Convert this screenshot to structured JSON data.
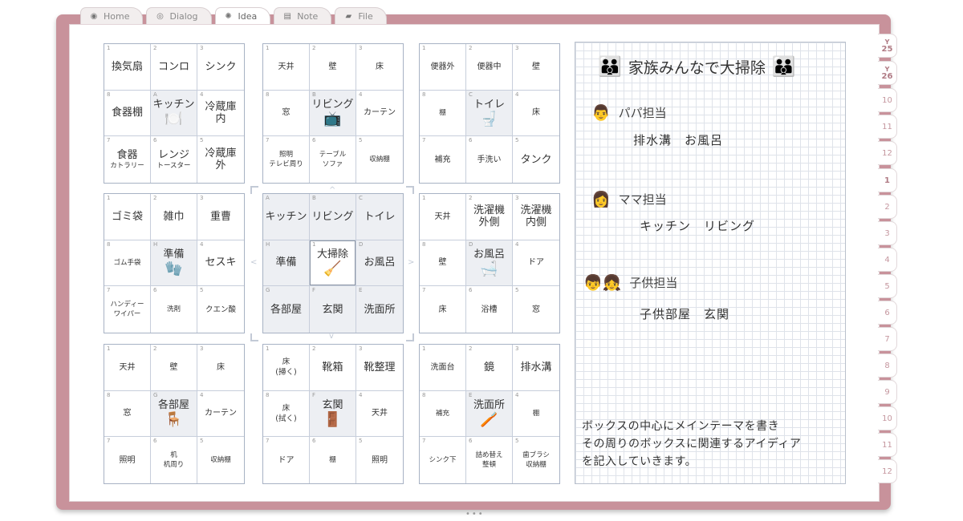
{
  "tabs": [
    {
      "label": "Home",
      "icon": "home-icon",
      "active": false
    },
    {
      "label": "Dialog",
      "icon": "dialog-icon",
      "active": false
    },
    {
      "label": "Idea",
      "icon": "lightbulb-icon",
      "active": true
    },
    {
      "label": "Note",
      "icon": "note-icon",
      "active": false
    },
    {
      "label": "File",
      "icon": "folder-icon",
      "active": false
    }
  ],
  "side_tabs": [
    {
      "label": "Y\n25",
      "style": "sel"
    },
    {
      "label": "Y\n26",
      "style": "sel"
    },
    {
      "label": "10",
      "style": ""
    },
    {
      "label": "11",
      "style": ""
    },
    {
      "label": "12",
      "style": ""
    },
    {
      "label": "1",
      "style": "sel"
    },
    {
      "label": "2",
      "style": ""
    },
    {
      "label": "3",
      "style": ""
    },
    {
      "label": "4",
      "style": ""
    },
    {
      "label": "5",
      "style": ""
    },
    {
      "label": "6",
      "style": ""
    },
    {
      "label": "7",
      "style": ""
    },
    {
      "label": "8",
      "style": ""
    },
    {
      "label": "9",
      "style": ""
    },
    {
      "label": "10",
      "style": ""
    },
    {
      "label": "11",
      "style": ""
    },
    {
      "label": "12",
      "style": ""
    }
  ],
  "blocks": [
    {
      "cells": [
        {
          "n": "1",
          "t": "換気扇"
        },
        {
          "n": "2",
          "t": "コンロ"
        },
        {
          "n": "3",
          "t": "シンク"
        },
        {
          "n": "8",
          "t": "食器棚"
        },
        {
          "n": "A",
          "t": "キッチン",
          "em": "🍽️",
          "center": true
        },
        {
          "n": "4",
          "t": "冷蔵庫\n内"
        },
        {
          "n": "7",
          "t": "食器",
          "s": "カトラリー"
        },
        {
          "n": "6",
          "t": "レンジ",
          "s": "トースター"
        },
        {
          "n": "5",
          "t": "冷蔵庫\n外"
        }
      ]
    },
    {
      "cells": [
        {
          "n": "1",
          "t": "天井",
          "cls": "s"
        },
        {
          "n": "2",
          "t": "壁",
          "cls": "s"
        },
        {
          "n": "3",
          "t": "床",
          "cls": "s"
        },
        {
          "n": "8",
          "t": "窓",
          "cls": "s"
        },
        {
          "n": "B",
          "t": "リビング",
          "em": "📺",
          "center": true
        },
        {
          "n": "4",
          "t": "カーテン",
          "cls": "s"
        },
        {
          "n": "7",
          "t": "照明\nテレビ周り",
          "cls": "xs"
        },
        {
          "n": "6",
          "t": "テーブル\nソファ",
          "cls": "xs"
        },
        {
          "n": "5",
          "t": "収納棚",
          "cls": "xs"
        }
      ]
    },
    {
      "cells": [
        {
          "n": "1",
          "t": "便器外",
          "cls": "s"
        },
        {
          "n": "2",
          "t": "便器中",
          "cls": "s"
        },
        {
          "n": "3",
          "t": "壁",
          "cls": "s"
        },
        {
          "n": "8",
          "t": "棚",
          "cls": "xs"
        },
        {
          "n": "C",
          "t": "トイレ",
          "em": "🚽",
          "center": true
        },
        {
          "n": "4",
          "t": "床",
          "cls": "s"
        },
        {
          "n": "7",
          "t": "補充",
          "cls": "s"
        },
        {
          "n": "6",
          "t": "手洗い",
          "cls": "s"
        },
        {
          "n": "5",
          "t": "タンク"
        }
      ]
    },
    {
      "cells": [
        {
          "n": "1",
          "t": "ゴミ袋"
        },
        {
          "n": "2",
          "t": "雑巾"
        },
        {
          "n": "3",
          "t": "重曹"
        },
        {
          "n": "8",
          "t": "ゴム手袋",
          "cls": "xs"
        },
        {
          "n": "H",
          "t": "準備",
          "em": "🧤",
          "center": true
        },
        {
          "n": "4",
          "t": "セスキ"
        },
        {
          "n": "7",
          "t": "ハンディー\nワイパー",
          "cls": "xs"
        },
        {
          "n": "6",
          "t": "洗剤",
          "cls": "xs"
        },
        {
          "n": "5",
          "t": "クエン酸",
          "cls": "sm2"
        }
      ]
    },
    {
      "center": true,
      "cells": [
        {
          "n": "A",
          "t": "キッチン"
        },
        {
          "n": "B",
          "t": "リビング"
        },
        {
          "n": "C",
          "t": "トイレ"
        },
        {
          "n": "H",
          "t": "準備"
        },
        {
          "n": "1",
          "t": "大掃除",
          "em": "🧹",
          "core": true
        },
        {
          "n": "D",
          "t": "お風呂"
        },
        {
          "n": "G",
          "t": "各部屋"
        },
        {
          "n": "F",
          "t": "玄関"
        },
        {
          "n": "E",
          "t": "洗面所"
        }
      ]
    },
    {
      "cells": [
        {
          "n": "1",
          "t": "天井",
          "cls": "s"
        },
        {
          "n": "2",
          "t": "洗濯機\n外側"
        },
        {
          "n": "3",
          "t": "洗濯機\n内側"
        },
        {
          "n": "8",
          "t": "壁",
          "cls": "s"
        },
        {
          "n": "D",
          "t": "お風呂",
          "em": "🛁",
          "center": true
        },
        {
          "n": "4",
          "t": "ドア",
          "cls": "s"
        },
        {
          "n": "7",
          "t": "床",
          "cls": "s"
        },
        {
          "n": "6",
          "t": "浴槽",
          "cls": "s"
        },
        {
          "n": "5",
          "t": "窓",
          "cls": "s"
        }
      ]
    },
    {
      "cells": [
        {
          "n": "1",
          "t": "天井",
          "cls": "s"
        },
        {
          "n": "2",
          "t": "壁",
          "cls": "s"
        },
        {
          "n": "3",
          "t": "床",
          "cls": "s"
        },
        {
          "n": "8",
          "t": "窓",
          "cls": "s"
        },
        {
          "n": "G",
          "t": "各部屋",
          "em": "🪑",
          "center": true
        },
        {
          "n": "4",
          "t": "カーテン",
          "cls": "s"
        },
        {
          "n": "7",
          "t": "照明",
          "cls": "s"
        },
        {
          "n": "6",
          "t": "机\n机周り",
          "cls": "xs"
        },
        {
          "n": "5",
          "t": "収納棚",
          "cls": "xs"
        }
      ]
    },
    {
      "cells": [
        {
          "n": "1",
          "t": "床\n(掃く)",
          "cls": "sm2"
        },
        {
          "n": "2",
          "t": "靴箱"
        },
        {
          "n": "3",
          "t": "靴整理"
        },
        {
          "n": "8",
          "t": "床\n(拭く)",
          "cls": "sm2"
        },
        {
          "n": "F",
          "t": "玄関",
          "em": "🚪",
          "center": true
        },
        {
          "n": "4",
          "t": "天井",
          "cls": "s"
        },
        {
          "n": "7",
          "t": "ドア",
          "cls": "s"
        },
        {
          "n": "6",
          "t": "棚",
          "cls": "xs"
        },
        {
          "n": "5",
          "t": "照明",
          "cls": "s"
        }
      ]
    },
    {
      "cells": [
        {
          "n": "1",
          "t": "洗面台",
          "cls": "s"
        },
        {
          "n": "2",
          "t": "鏡"
        },
        {
          "n": "3",
          "t": "排水溝"
        },
        {
          "n": "8",
          "t": "補充",
          "cls": "xs"
        },
        {
          "n": "E",
          "t": "洗面所",
          "em": "🪥",
          "center": true
        },
        {
          "n": "4",
          "t": "棚",
          "cls": "xs"
        },
        {
          "n": "7",
          "t": "シンク下",
          "cls": "xs"
        },
        {
          "n": "6",
          "t": "詰め替え\n整頓",
          "cls": "xs"
        },
        {
          "n": "5",
          "t": "歯ブラシ\n収納棚",
          "cls": "xs"
        }
      ]
    }
  ],
  "notebook": {
    "title": "家族みんなで大掃除",
    "title_icon": "👪",
    "roles": [
      {
        "icon": "👨",
        "label": "パパ担当",
        "duty": "排水溝　お風呂"
      },
      {
        "icon": "👩",
        "label": "ママ担当",
        "duty": "キッチン　リビング"
      },
      {
        "icon": "👦👧",
        "label": "子供担当",
        "duty": "子供部屋　玄関"
      }
    ],
    "memo": [
      "ボックスの中心にメインテーマを書き",
      "その周りのボックスに関連するアイディア",
      "を記入していきます。"
    ]
  },
  "pager_dots": "•••"
}
